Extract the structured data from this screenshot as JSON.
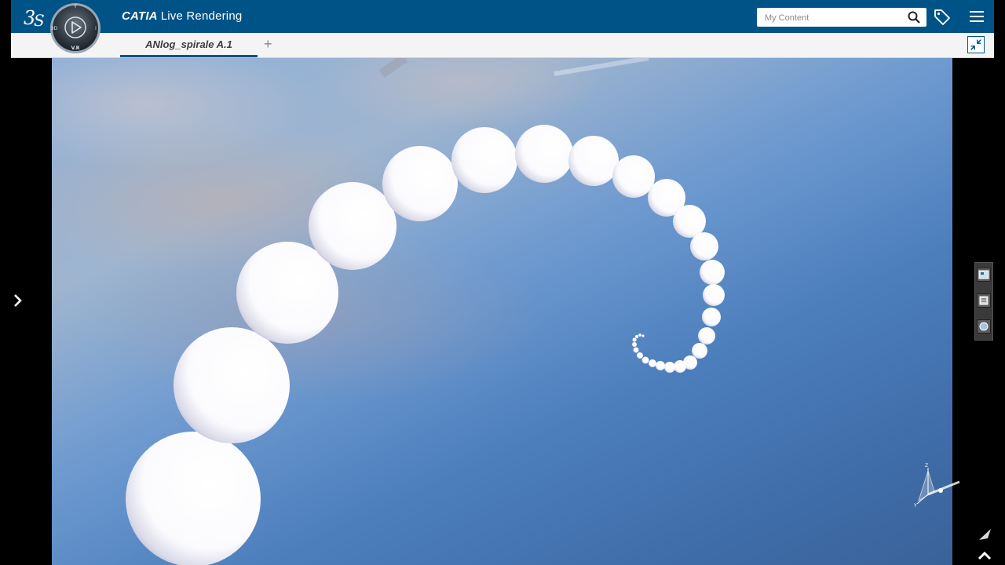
{
  "header": {
    "brand": "CATIA",
    "app_name": "Live Rendering",
    "search_placeholder": "My Content",
    "compass_label": "V.R",
    "compass_left": "3D",
    "compass_right": "i"
  },
  "tabs": [
    {
      "label": "ANlog_spirale A.1",
      "active": true
    }
  ],
  "tab_add_label": "+",
  "axis": {
    "z": "Z",
    "y": "Y"
  },
  "colors": {
    "header_bg": "#005386",
    "tab_accent": "#005386",
    "sphere": "#ffffff"
  },
  "icons": {
    "logo": "dassault-systemes-logo",
    "compass": "compass-play-icon",
    "search": "search-icon",
    "tag": "tag-icon",
    "menu": "hamburger-menu-icon",
    "collapse": "collapse-arrows-icon",
    "expand_panel": "chevron-right-icon"
  }
}
